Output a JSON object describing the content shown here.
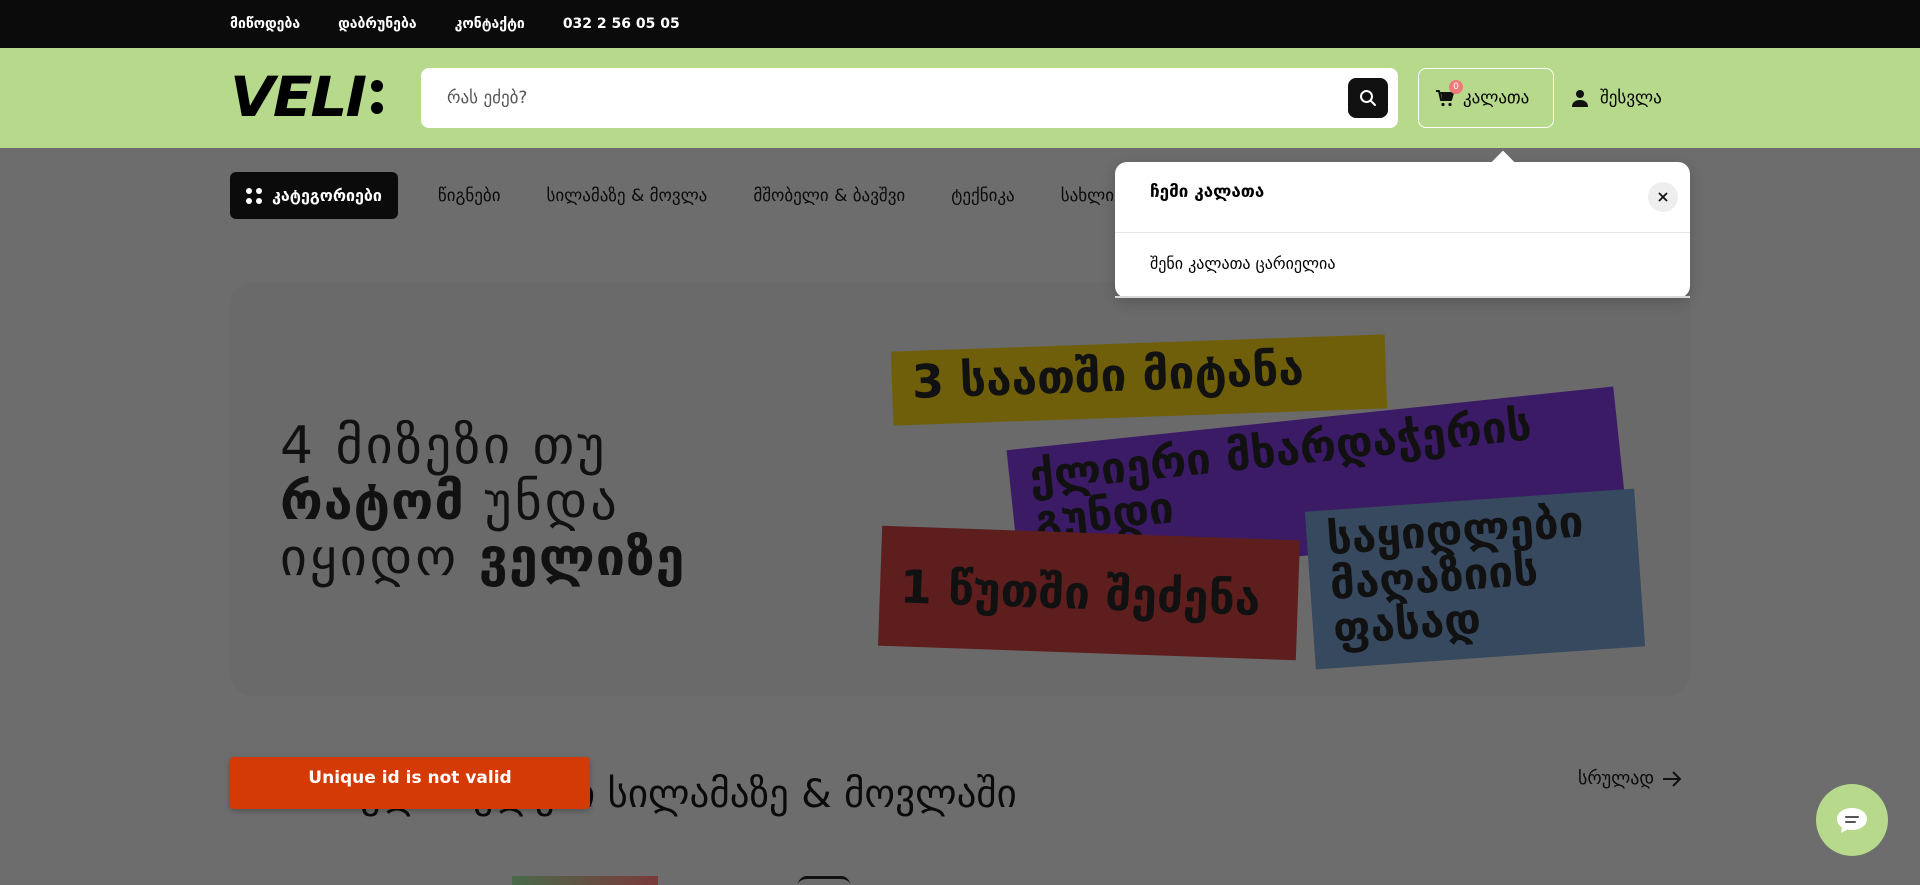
{
  "topbar": {
    "links": [
      "მიწოდება",
      "დაბრუნება",
      "კონტაქტი",
      "032 2 56 05 05"
    ]
  },
  "header": {
    "logo": "VELI",
    "search_placeholder": "რას ეძებ?",
    "cart_label": "კალათა",
    "cart_count": "0",
    "login_label": "შესვლა"
  },
  "nav": {
    "categories_label": "კატეგორიები",
    "items": [
      "წიგნები",
      "სილამაზე & მოვლა",
      "მშობელი & ბავშვი",
      "ტექნიკა",
      "სახლი"
    ]
  },
  "banner": {
    "line1": "4 მიზეზი თუ",
    "line2_bold": "რატომ",
    "line2": "უნდა",
    "line3": "იყიდო",
    "line3_bold": "ველიზე",
    "stickers": [
      "3 საათში მიტანა",
      "ქლიერი მხარდაჭერის გუნდი",
      "1 წუთში შეძენა",
      "საყიდლები მაღაზიის ფასად"
    ]
  },
  "section": {
    "title": "პოპულარულები სილამაზე & მოვლაში",
    "see_all": "სრულად"
  },
  "toast": {
    "message": "Unique id is not valid"
  },
  "cart_dropdown": {
    "title": "ჩემი კალათა",
    "empty_text": "შენი კალათა ცარიელია"
  },
  "colors": {
    "header_bg": "#b6d98b",
    "topbar_bg": "#0b0b0b",
    "toast_bg": "#d33a06",
    "badge": "#f07a7a"
  }
}
